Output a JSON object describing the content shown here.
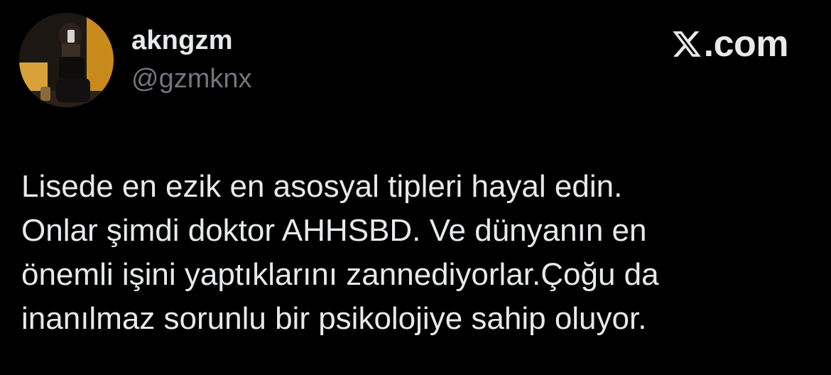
{
  "author": {
    "display_name": "akngzm",
    "handle": "@gzmknx",
    "avatar_icon": "profile-photo"
  },
  "brand": {
    "logo_icon": "x-logo-icon",
    "text": ".com"
  },
  "tweet": {
    "lines": [
      "Lisede en ezik en asosyal tipleri hayal edin.",
      "Onlar şimdi doktor AHHSBD. Ve dünyanın en",
      "önemli işini yaptıklarını zannediyorlar.Çoğu da",
      "inanılmaz sorunlu bir psikolojiye sahip oluyor."
    ]
  },
  "colors": {
    "background": "#000000",
    "primary_text": "#e7e9ea",
    "secondary_text": "#71767b"
  }
}
